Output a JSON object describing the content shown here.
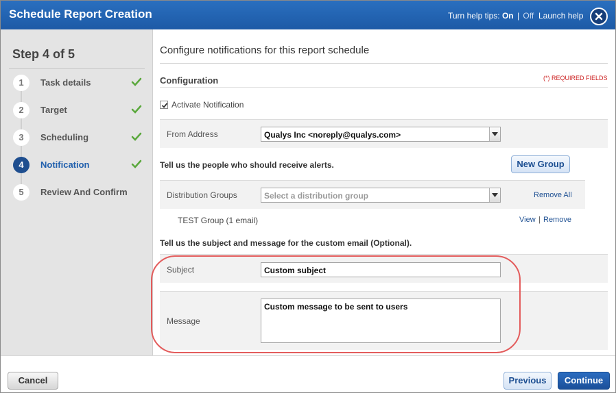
{
  "window": {
    "title": "Schedule Report Creation",
    "help_tips_label": "Turn help tips:",
    "help_on": "On",
    "help_sep": "|",
    "help_off": "Off",
    "launch_help": "Launch help",
    "close_icon": "close-icon"
  },
  "sidebar": {
    "heading": "Step 4 of 5",
    "steps": [
      {
        "num": "1",
        "label": "Task details",
        "done": true
      },
      {
        "num": "2",
        "label": "Target",
        "done": true
      },
      {
        "num": "3",
        "label": "Scheduling",
        "done": true
      },
      {
        "num": "4",
        "label": "Notification",
        "done": true,
        "active": true
      },
      {
        "num": "5",
        "label": "Review And Confirm",
        "done": false
      }
    ]
  },
  "main": {
    "title": "Configure notifications for this report schedule",
    "config_heading": "Configuration",
    "required_note": "(*) REQUIRED FIELDS",
    "activate_label": "Activate Notification",
    "activate_checked": true,
    "from_label": "From Address",
    "from_value": "Qualys Inc <noreply@qualys.com>",
    "recipients_prompt": "Tell us the people who should receive alerts.",
    "new_group_button": "New Group",
    "dist_label": "Distribution Groups",
    "dist_placeholder": "Select a distribution group",
    "remove_all": "Remove All",
    "group_name": "TEST Group (1 email)",
    "view_link": "View",
    "link_sep": "|",
    "remove_link": "Remove",
    "custom_prompt": "Tell us the subject and message for the custom email (Optional).",
    "subject_label": "Subject",
    "subject_value": "Custom subject",
    "message_label": "Message",
    "message_value": "Custom message to be sent to users"
  },
  "footer": {
    "cancel": "Cancel",
    "previous": "Previous",
    "continue": "Continue"
  },
  "colors": {
    "header": "#1d5aa6",
    "accent": "#2160ad",
    "highlight": "#e35c5c",
    "check": "#5aa83c"
  }
}
